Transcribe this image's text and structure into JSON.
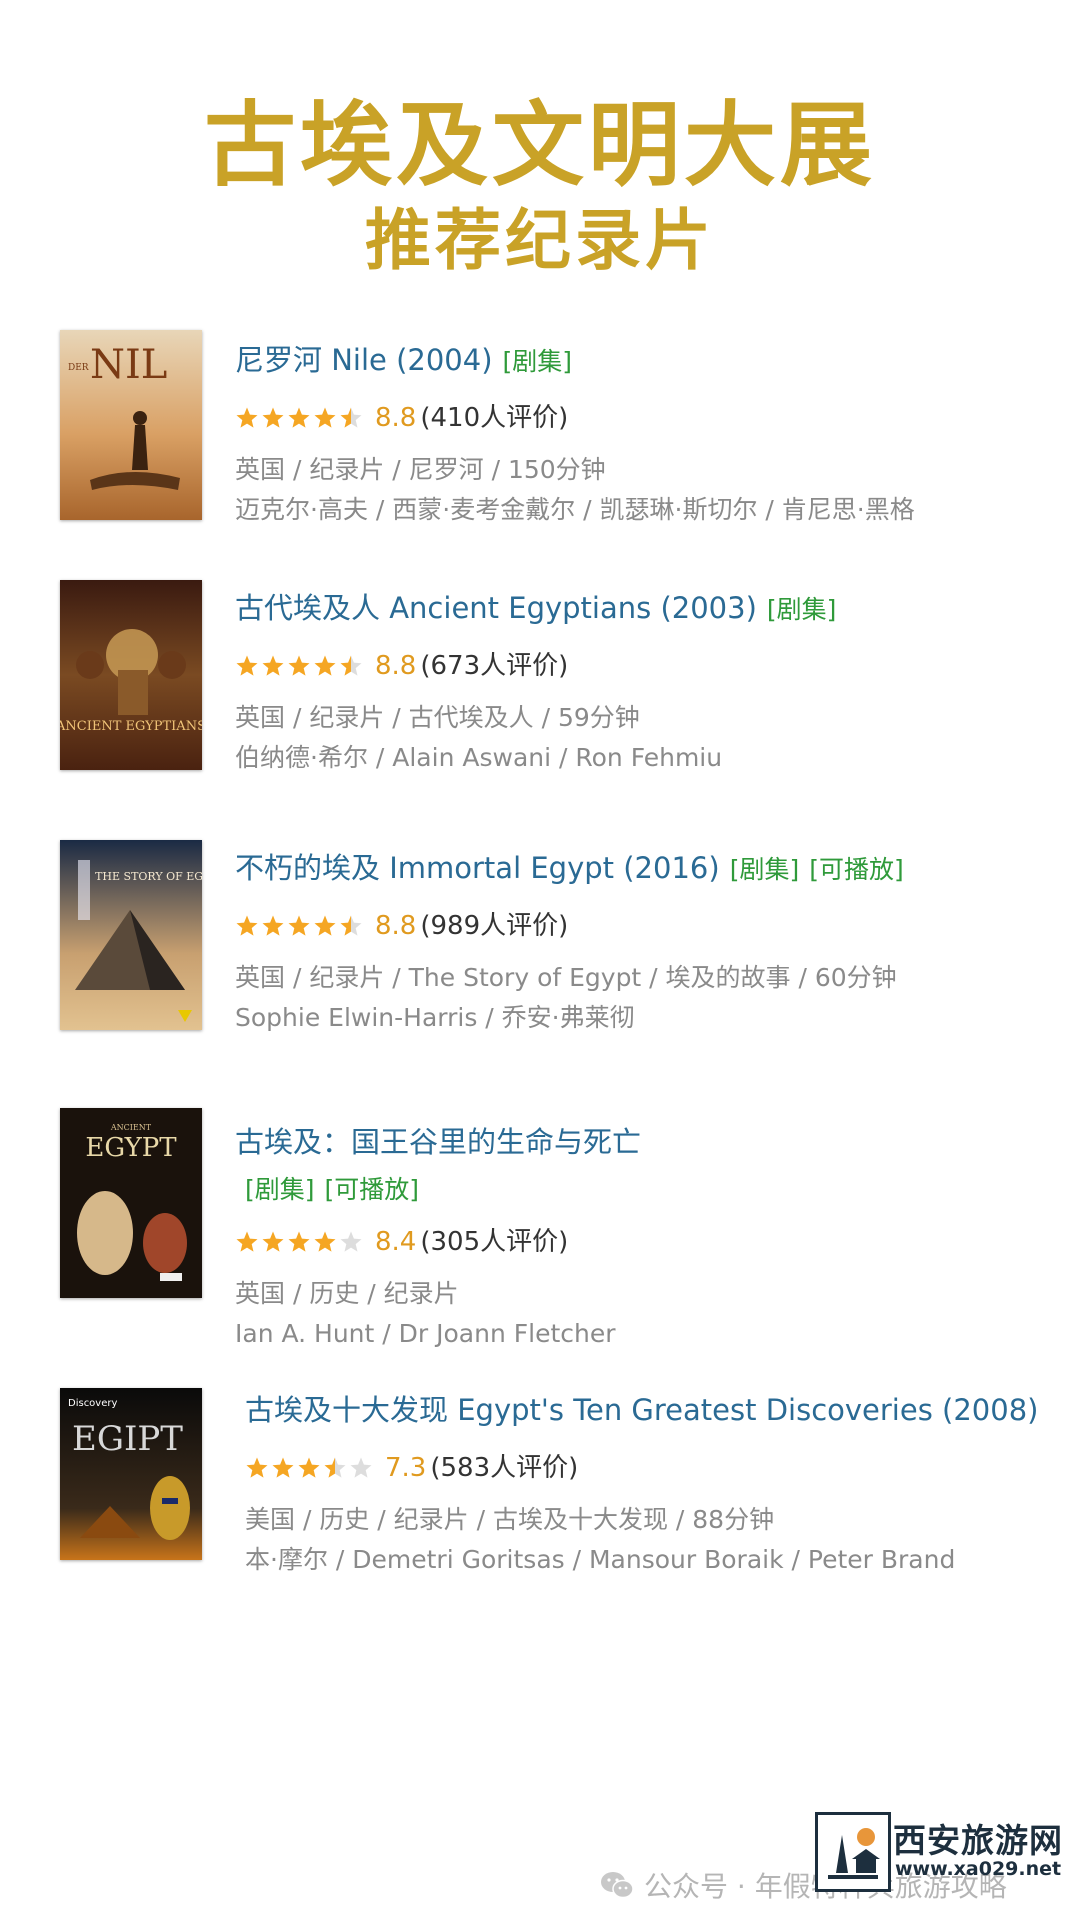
{
  "header": {
    "title": "古埃及文明大展",
    "subtitle": "推荐纪录片"
  },
  "colors": {
    "title_gold": "#c9a227",
    "link_blue": "#2a6a94",
    "tag_green": "#2f9a3a",
    "star_orange": "#f5a623",
    "score_orange": "#e09a1f",
    "meta_gray": "#8a8a8a"
  },
  "items": [
    {
      "title": "尼罗河 Nile (2004)",
      "tags": [
        "[剧集]"
      ],
      "stars": 4.5,
      "score": "8.8",
      "count": "(410人评价)",
      "meta1": "英国 / 纪录片 / 尼罗河 / 150分钟",
      "meta2": "迈克尔·高夫 / 西蒙·麦考金戴尔 / 凯瑟琳·斯切尔 / 肯尼思·黑格",
      "poster": {
        "text": "NIL",
        "small": "DER"
      }
    },
    {
      "title": "古代埃及人 Ancient Egyptians (2003)",
      "tags": [
        "[剧集]"
      ],
      "stars": 4.5,
      "score": "8.8",
      "count": "(673人评价)",
      "meta1": "英国 / 纪录片 / 古代埃及人 / 59分钟",
      "meta2": "伯纳德·希尔 / Alain Aswani / Ron Fehmiu",
      "poster": {
        "text": "ANCIENT EGYPTIANS"
      }
    },
    {
      "title": "不朽的埃及 Immortal Egypt (2016)",
      "tags": [
        "[剧集]",
        "[可播放]"
      ],
      "stars": 4.5,
      "score": "8.8",
      "count": "(989人评价)",
      "meta1": "英国 / 纪录片 / The Story of Egypt / 埃及的故事 / 60分钟",
      "meta2": "Sophie Elwin-Harris / 乔安·弗莱彻",
      "poster": {
        "text": "THE STORY OF EGYPT"
      }
    },
    {
      "title": "古埃及：国王谷里的生命与死亡",
      "tags": [
        "[剧集]",
        "[可播放]"
      ],
      "stars": 4,
      "score": "8.4",
      "count": "(305人评价)",
      "meta1": "英国 / 历史 / 纪录片",
      "meta2": "Ian A. Hunt / Dr Joann Fletcher",
      "poster": {
        "text": "EGYPT",
        "small": "ANCIENT"
      }
    },
    {
      "title": "古埃及十大发现 Egypt's Ten Greatest Discoveries (2008)",
      "tags": [],
      "stars": 3.5,
      "score": "7.3",
      "count": "(583人评价)",
      "meta1": "美国 / 历史 / 纪录片 / 古埃及十大发现 / 88分钟",
      "meta2": "本·摩尔 / Demetri Goritsas / Mansour Boraik / Peter Brand",
      "poster": {
        "text": "EGIPT",
        "small": "Discovery"
      }
    }
  ],
  "footer": {
    "text": "公众号 · 年假特种兵旅游攻略",
    "icon": "wechat-icon"
  },
  "logo": {
    "name": "西安旅游网",
    "url": "www.xa029.net"
  }
}
